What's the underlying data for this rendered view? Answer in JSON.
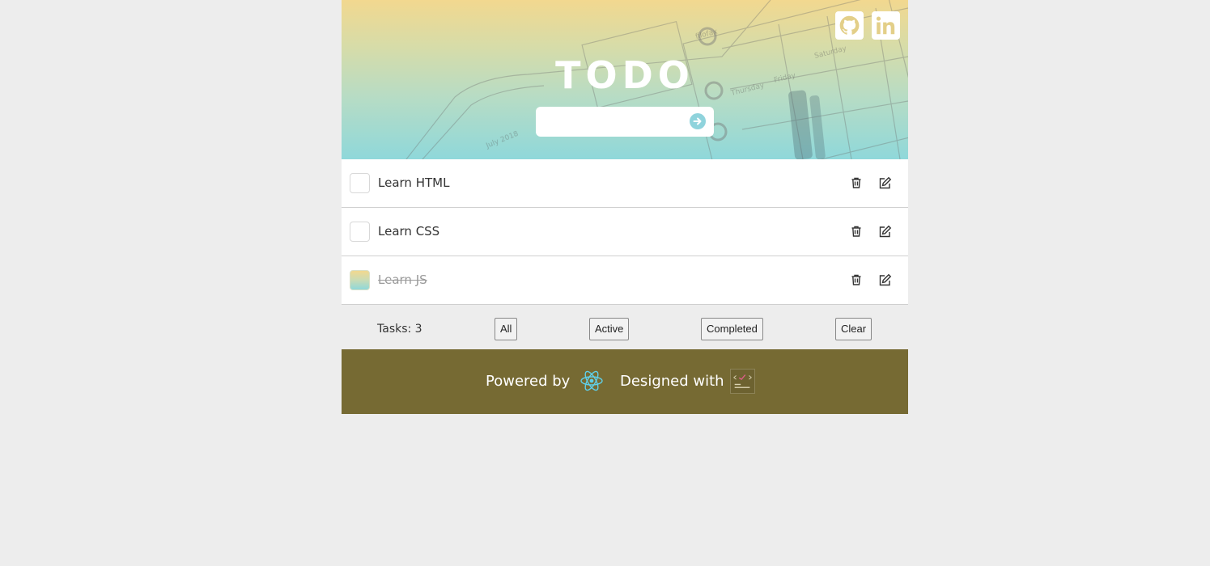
{
  "header": {
    "title": "TODO",
    "input_value": "",
    "add_icon": "arrow-right-circle-icon",
    "social": [
      {
        "name": "github",
        "icon": "github-icon"
      },
      {
        "name": "linkedin",
        "icon": "linkedin-icon"
      }
    ]
  },
  "todos": [
    {
      "text": "Learn HTML",
      "completed": false
    },
    {
      "text": "Learn CSS",
      "completed": false
    },
    {
      "text": "Learn JS",
      "completed": true
    }
  ],
  "footer": {
    "task_count": "Tasks: 3",
    "filters": {
      "all": "All",
      "active": "Active",
      "completed": "Completed",
      "clear": "Clear"
    }
  },
  "credits": {
    "powered_by": "Powered by",
    "designed_with": "Designed with",
    "powered_icon": "react-logo-icon"
  },
  "colors": {
    "gradient_top": "#f2d88f",
    "gradient_bottom": "#8fd8da",
    "credits_bg": "#766a33",
    "page_bg": "#ededed"
  }
}
